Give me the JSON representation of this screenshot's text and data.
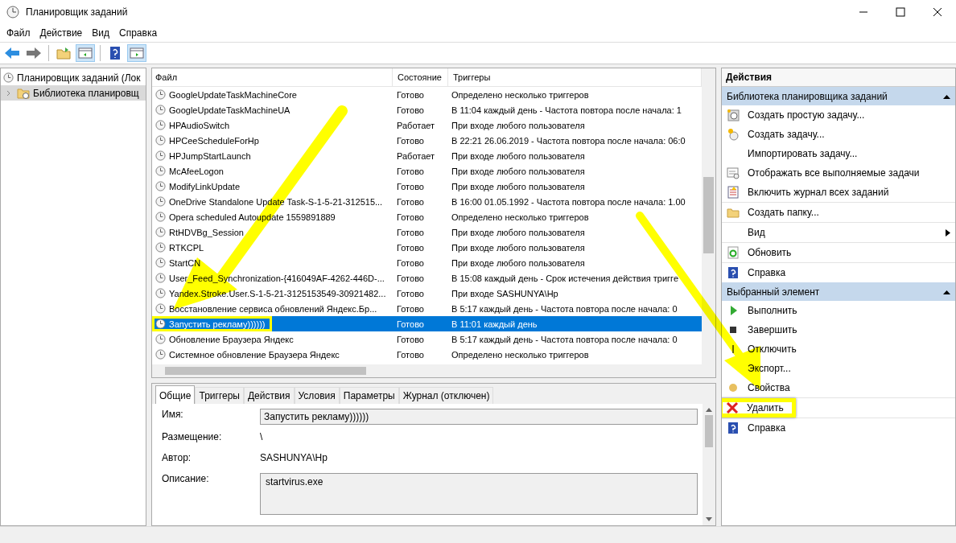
{
  "window": {
    "title": "Планировщик заданий"
  },
  "menu": [
    "Файл",
    "Действие",
    "Вид",
    "Справка"
  ],
  "tree": [
    {
      "label": "Планировщик заданий (Лок",
      "children": [
        {
          "label": "Библиотека планировщ",
          "expanded": false,
          "selected": true
        }
      ]
    }
  ],
  "table": {
    "columns": [
      "Файл",
      "Состояние",
      "Триггеры"
    ],
    "rows": [
      {
        "name": "GoogleUpdateTaskMachineCore",
        "status": "Готово",
        "trigger": "Определено несколько триггеров",
        "selected": false
      },
      {
        "name": "GoogleUpdateTaskMachineUA",
        "status": "Готово",
        "trigger": "В 11:04 каждый день - Частота повтора после начала: 1",
        "selected": false
      },
      {
        "name": "HPAudioSwitch",
        "status": "Работает",
        "trigger": "При входе любого пользователя",
        "selected": false
      },
      {
        "name": "HPCeeScheduleForHp",
        "status": "Готово",
        "trigger": "В 22:21 26.06.2019 - Частота повтора после начала: 06:0",
        "selected": false
      },
      {
        "name": "HPJumpStartLaunch",
        "status": "Работает",
        "trigger": "При входе любого пользователя",
        "selected": false
      },
      {
        "name": "McAfeeLogon",
        "status": "Готово",
        "trigger": "При входе любого пользователя",
        "selected": false
      },
      {
        "name": "ModifyLinkUpdate",
        "status": "Готово",
        "trigger": "При входе любого пользователя",
        "selected": false
      },
      {
        "name": "OneDrive Standalone Update Task-S-1-5-21-312515...",
        "status": "Готово",
        "trigger": "В 16:00 01.05.1992 - Частота повтора после начала: 1.00",
        "selected": false
      },
      {
        "name": "Opera scheduled Autoupdate 1559891889",
        "status": "Готово",
        "trigger": "Определено несколько триггеров",
        "selected": false
      },
      {
        "name": "RtHDVBg_Session",
        "status": "Готово",
        "trigger": "При входе любого пользователя",
        "selected": false
      },
      {
        "name": "RTKCPL",
        "status": "Готово",
        "trigger": "При входе любого пользователя",
        "selected": false
      },
      {
        "name": "StartCN",
        "status": "Готово",
        "trigger": "При входе любого пользователя",
        "selected": false
      },
      {
        "name": "User_Feed_Synchronization-{416049AF-4262-446D-...",
        "status": "Готово",
        "trigger": "В 15:08 каждый день - Срок истечения действия тригге",
        "selected": false
      },
      {
        "name": "Yandex.Stroke.User.S-1-5-21-3125153549-30921482...",
        "status": "Готово",
        "trigger": "При входе SASHUNYA\\Hp",
        "selected": false
      },
      {
        "name": "Восстановление сервиса обновлений Яндекс.Бр...",
        "status": "Готово",
        "trigger": "В 5:17 каждый день - Частота повтора после начала: 0",
        "selected": false
      },
      {
        "name": "Запустить рекламу))))))",
        "status": "Готово",
        "trigger": "В 11:01 каждый день",
        "selected": true
      },
      {
        "name": "Обновление Браузера Яндекс",
        "status": "Готово",
        "trigger": "В 5:17 каждый день - Частота повтора после начала: 0",
        "selected": false
      },
      {
        "name": "Системное обновление Браузера Яндекс",
        "status": "Готово",
        "trigger": "Определено несколько триггеров",
        "selected": false
      }
    ]
  },
  "details": {
    "tabs": [
      {
        "label": "Общие",
        "selected": true
      },
      {
        "label": "Триггеры",
        "selected": false
      },
      {
        "label": "Действия",
        "selected": false
      },
      {
        "label": "Условия",
        "selected": false
      },
      {
        "label": "Параметры",
        "selected": false
      },
      {
        "label": "Журнал (отключен)",
        "selected": false
      }
    ],
    "fields": [
      {
        "label": "Имя:",
        "value": "Запустить рекламу))))))",
        "kind": "input"
      },
      {
        "label": "Размещение:",
        "value": "\\",
        "kind": "text"
      },
      {
        "label": "Автор:",
        "value": "SASHUNYA\\Hp",
        "kind": "text"
      },
      {
        "label": "Описание:",
        "value": "startvirus.exe",
        "kind": "textarea"
      }
    ]
  },
  "actions": {
    "title": "Действия",
    "sections": [
      {
        "title": "Библиотека планировщика заданий",
        "items": [
          {
            "label": "Создать простую задачу...",
            "kind": "wizard",
            "submenu": false,
            "highlighted": false
          },
          {
            "label": "Создать задачу...",
            "kind": "task",
            "submenu": false,
            "highlighted": false
          },
          {
            "label": "Импортировать задачу...",
            "kind": "plain",
            "submenu": false,
            "highlighted": false
          },
          {
            "label": "Отображать все выполняемые задачи",
            "kind": "list",
            "submenu": false,
            "highlighted": false
          },
          {
            "label": "Включить журнал всех заданий",
            "kind": "log",
            "submenu": false,
            "highlighted": false
          },
          {
            "label": "Создать папку...",
            "kind": "folder",
            "submenu": false,
            "highlighted": false
          },
          {
            "label": "Вид",
            "kind": "plain",
            "submenu": true,
            "highlighted": false
          },
          {
            "label": "Обновить",
            "kind": "refresh",
            "submenu": false,
            "highlighted": false
          },
          {
            "label": "Справка",
            "kind": "help",
            "submenu": false,
            "highlighted": false
          }
        ]
      },
      {
        "title": "Выбранный элемент",
        "items": [
          {
            "label": "Выполнить",
            "kind": "run",
            "submenu": false,
            "highlighted": false
          },
          {
            "label": "Завершить",
            "kind": "stop",
            "submenu": false,
            "highlighted": false
          },
          {
            "label": "Отключить",
            "kind": "disable",
            "submenu": false,
            "highlighted": false
          },
          {
            "label": "Экспорт...",
            "kind": "plain",
            "submenu": false,
            "highlighted": false
          },
          {
            "label": "Свойства",
            "kind": "props",
            "submenu": false,
            "highlighted": false
          },
          {
            "label": "Удалить",
            "kind": "delete",
            "submenu": false,
            "highlighted": true
          },
          {
            "label": "Справка",
            "kind": "help",
            "submenu": false,
            "highlighted": false
          }
        ]
      }
    ]
  }
}
